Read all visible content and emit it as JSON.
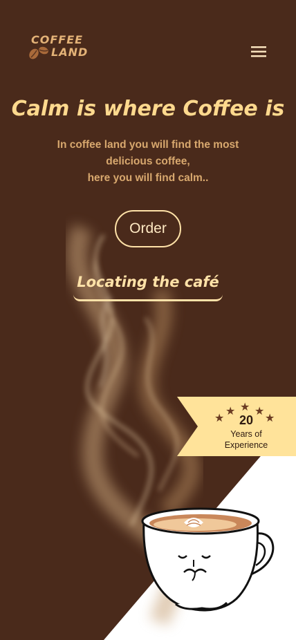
{
  "header": {
    "logo_line1": "COFFEE",
    "logo_line2": "LAND",
    "menu_icon": "hamburger-menu-icon"
  },
  "hero": {
    "title": "Calm is where Coffee is",
    "subtitle_lines": [
      "In coffee land you will find the most",
      "delicious coffee,",
      "here you will find calm.."
    ],
    "order_label": "Order",
    "locate_label": "Locating the café"
  },
  "experience": {
    "number": "20",
    "label_line1": "Years of",
    "label_line2": "Experience",
    "stars_icon": "stars-icon"
  },
  "illustration": {
    "icon": "coffee-cup-illustration"
  },
  "colors": {
    "background": "#4a2a1b",
    "accent": "#ffd98e",
    "badge": "#ffe39a",
    "subtitle": "#d8a86e"
  }
}
